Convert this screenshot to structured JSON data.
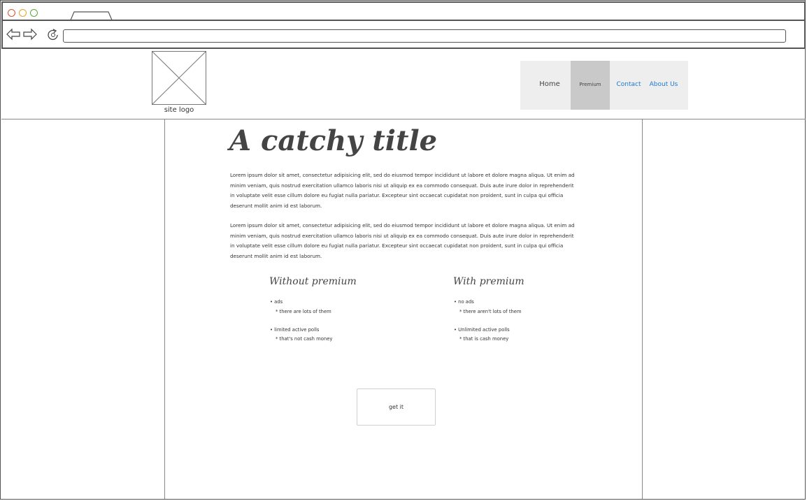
{
  "browser": {
    "traffic_lights": {
      "close": "#d9532c",
      "minimize": "#e0a52a",
      "maximize": "#5aa83a"
    },
    "url": ""
  },
  "header": {
    "logo_caption": "site logo",
    "menu": [
      {
        "label": "Home",
        "active": false,
        "color": "#444444"
      },
      {
        "label": "Premium",
        "active": true,
        "color": "#444444"
      },
      {
        "label": "Contact",
        "active": false,
        "color": "#1a7bd0"
      },
      {
        "label": "About Us",
        "active": false,
        "color": "#1a7bd0"
      }
    ]
  },
  "main": {
    "title": "A catchy title",
    "paragraphs": [
      "Lorem ipsum dolor sit amet, consectetur adipisicing elit, sed do eiusmod tempor incididunt ut labore et dolore magna aliqua. Ut enim ad minim veniam, quis nostrud exercitation ullamco laboris nisi ut aliquip ex ea commodo consequat. Duis aute irure dolor in reprehenderit in voluptate velit esse cillum dolore eu fugiat nulla pariatur. Excepteur sint occaecat cupidatat non proident, sunt in culpa qui officia deserunt mollit anim id est laborum.",
      "Lorem ipsum dolor sit amet, consectetur adipisicing elit, sed do eiusmod tempor incididunt ut labore et dolore magna aliqua. Ut enim ad minim veniam, quis nostrud exercitation ullamco laboris nisi ut aliquip ex ea commodo consequat. Duis aute irure dolor in reprehenderit in voluptate velit esse cillum dolore eu fugiat nulla pariatur. Excepteur sint occaecat cupidatat non proident, sunt in culpa qui officia deserunt mollit anim id est laborum."
    ],
    "comparison": {
      "without": {
        "title": "Without premium",
        "items": [
          {
            "label": "• ads",
            "note": "* there are lots of them"
          },
          {
            "label": "• limited active polls",
            "note": "* that's not cash money"
          }
        ]
      },
      "with": {
        "title": "With premium",
        "items": [
          {
            "label": "• no ads",
            "note": "* there aren't lots of them"
          },
          {
            "label": "• Unlimited active polls",
            "note": "* that is cash money"
          }
        ]
      }
    },
    "cta_label": "get it"
  }
}
